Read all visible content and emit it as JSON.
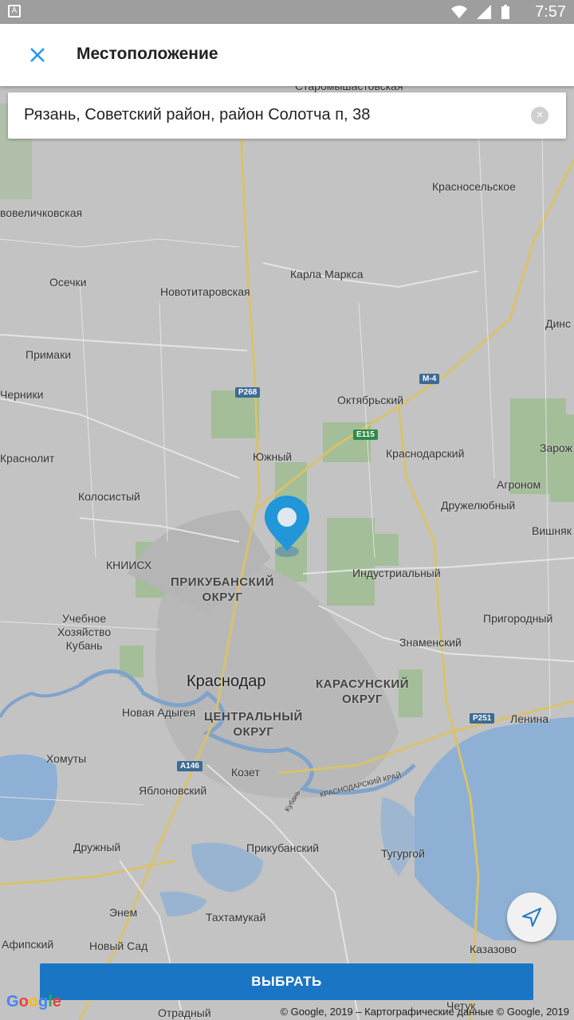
{
  "status_bar": {
    "time": "7:57"
  },
  "app_bar": {
    "title": "Местоположение",
    "close_icon": "close-icon"
  },
  "search": {
    "value": "Рязань, Советский район, район Солотча п, 38"
  },
  "map": {
    "labels": {
      "staromyshastovskaya": "Старомышастовская",
      "krasnoselskoe": "Красносельское",
      "novovelichkovskaya": "вовеличковская",
      "karla_marksa": "Карла Маркса",
      "osechki": "Осечки",
      "novotitarovskaya": "Новотитаровская",
      "dins": "Динс",
      "primaki": "Примаки",
      "cherniki": "Черники",
      "oktyabrsky": "Октябрьский",
      "zarozh": "Зарож",
      "krasnolit": "Краснолит",
      "yuzhny": "Южный",
      "krasnodarsky": "Краснодарский",
      "agronom": "Агроном",
      "kolosisty": "Колосистый",
      "druzhelyubny": "Дружелюбный",
      "vishnyak": "Вишняк",
      "kniish": "КНИИСХ",
      "industrialny": "Индустриальный",
      "prikubansky_okrug_1": "ПРИКУБАНСКИЙ",
      "prikubansky_okrug_2": "ОКРУГ",
      "uchebnoe_1": "Учебное",
      "uchebnoe_2": "Хозяйство",
      "uchebnoe_3": "Кубань",
      "prigorodny": "Пригородный",
      "znamensky": "Знаменский",
      "krasnodar": "Краснодар",
      "karasunsky_1": "КАРАСУНСКИЙ",
      "karasunsky_2": "ОКРУГ",
      "novaya_adygeya": "Новая Адыгея",
      "centralny_1": "ЦЕНТРАЛЬНЫЙ",
      "centralny_2": "ОКРУГ",
      "lenina": "Ленина",
      "khomuty": "Хомуты",
      "kozet": "Козет",
      "yablonovsky": "Яблоновский",
      "krasnodarsky_krai": "КРАСНОДАРСКИЙ КРАЙ",
      "kuban": "Кубань",
      "druzhny": "Дружный",
      "prikubansky": "Прикубанский",
      "tugurgoy": "Тугургой",
      "enem": "Энем",
      "takhtamukay": "Тахтамукай",
      "afipsky": "Афипский",
      "novy_sad": "Новый Сад",
      "kazazovo": "Казазово",
      "otradny": "Отрадный",
      "chetuk": "Четук"
    },
    "road_badges": {
      "r268": "P268",
      "m4": "M-4",
      "e115": "E115",
      "r251": "P251",
      "a146": "A146"
    }
  },
  "locate_button": {
    "icon": "navigation-arrow-icon"
  },
  "choose_button": {
    "label": "ВЫБРАТЬ"
  },
  "google_logo": "Google",
  "attribution": "© Google, 2019 – Картографические данные © Google, 2019",
  "colors": {
    "accent": "#1a76c4",
    "pin": "#2196d8",
    "close": "#2196f3"
  }
}
